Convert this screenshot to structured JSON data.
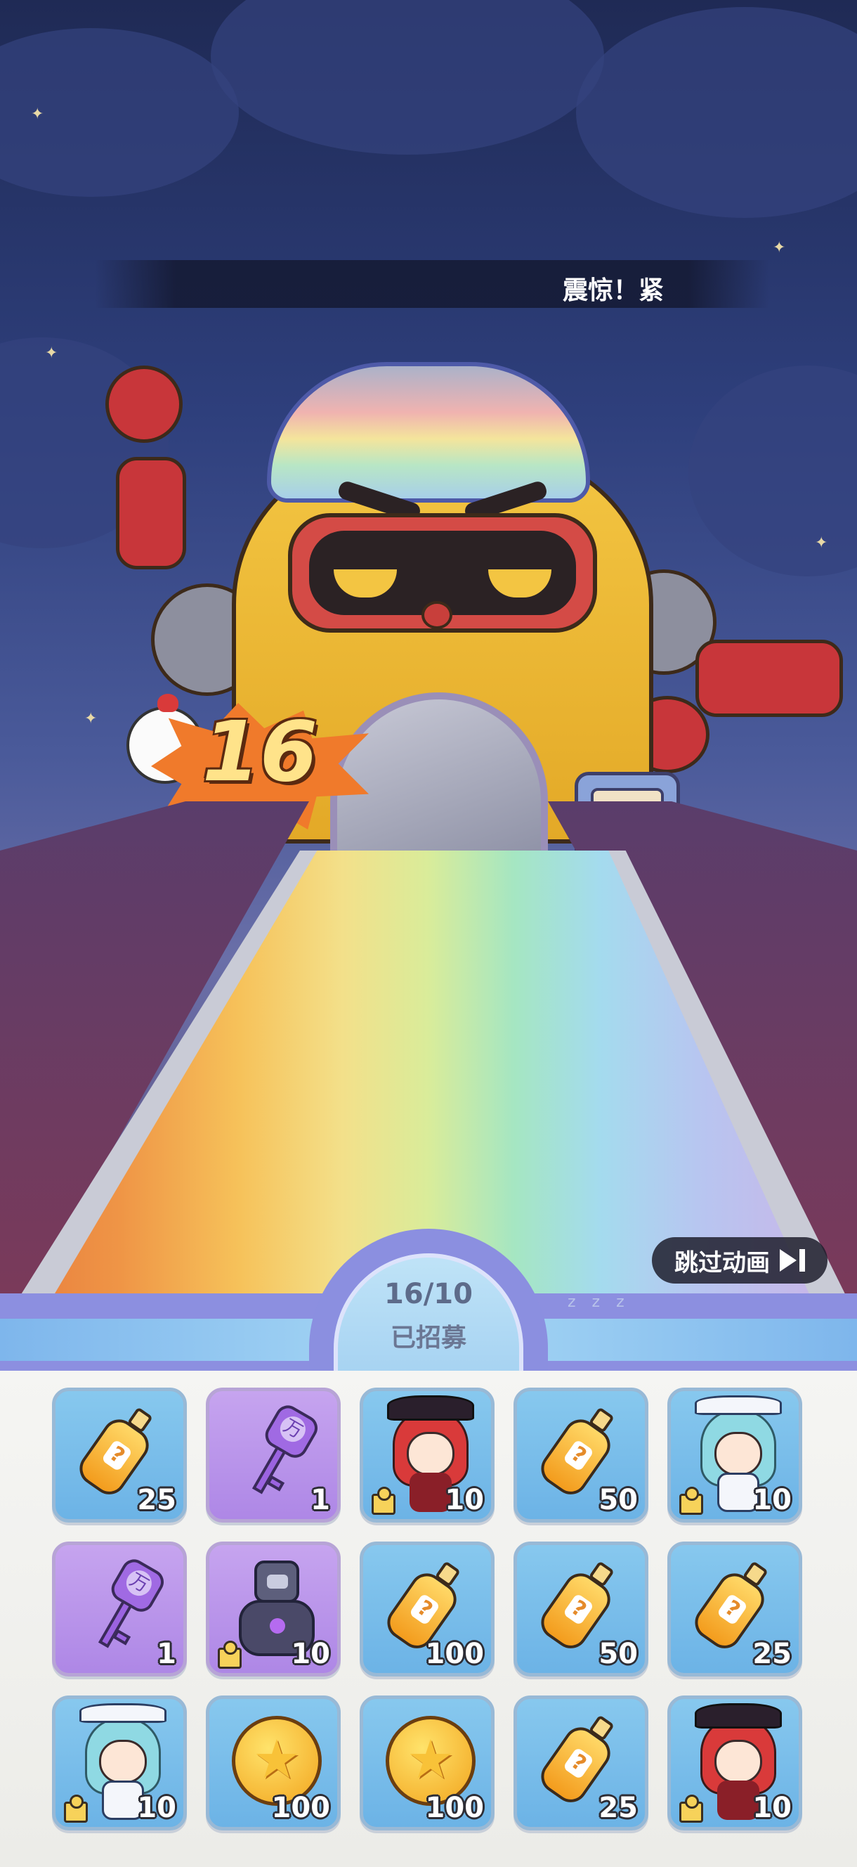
{
  "announcement": {
    "text": "震惊！紧"
  },
  "pull_badge": {
    "number": "16"
  },
  "skip_button": {
    "label": "跳过动画"
  },
  "counter": {
    "value": "16/10",
    "label": "已招募"
  },
  "rewards": [
    {
      "icon": "potion-bottle-icon",
      "bg": "blue",
      "qty": "25"
    },
    {
      "icon": "purple-key-icon",
      "bg": "purple",
      "qty": "1"
    },
    {
      "icon": "witch-character-icon",
      "bg": "blue",
      "qty": "10",
      "shard": true
    },
    {
      "icon": "potion-bottle-icon",
      "bg": "blue",
      "qty": "50"
    },
    {
      "icon": "sailor-character-icon",
      "bg": "blue",
      "qty": "10",
      "shard": true
    },
    {
      "icon": "purple-key-icon",
      "bg": "purple",
      "qty": "1"
    },
    {
      "icon": "mech-character-icon",
      "bg": "purple",
      "qty": "10",
      "shard": true
    },
    {
      "icon": "potion-bottle-icon",
      "bg": "blue",
      "qty": "100"
    },
    {
      "icon": "potion-bottle-icon",
      "bg": "blue",
      "qty": "50"
    },
    {
      "icon": "potion-bottle-icon",
      "bg": "blue",
      "qty": "25"
    },
    {
      "icon": "sailor-character-icon",
      "bg": "blue",
      "qty": "10",
      "shard": true
    },
    {
      "icon": "gold-coin-icon",
      "bg": "blue",
      "qty": "100"
    },
    {
      "icon": "gold-coin-icon",
      "bg": "blue",
      "qty": "100"
    },
    {
      "icon": "potion-bottle-icon",
      "bg": "blue",
      "qty": "25"
    },
    {
      "icon": "witch-character-icon",
      "bg": "blue",
      "qty": "10",
      "shard": true
    }
  ]
}
